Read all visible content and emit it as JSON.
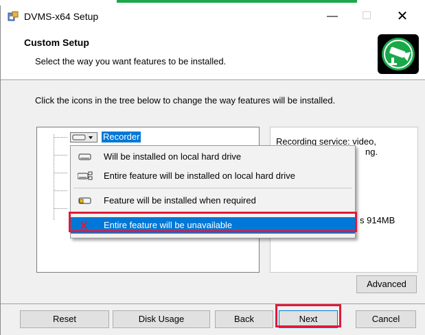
{
  "window": {
    "title": "DVMS-x64 Setup",
    "minimize_glyph": "—",
    "maximize_glyph": "☐",
    "close_glyph": "✕"
  },
  "header": {
    "title": "Custom Setup",
    "subtitle": "Select the way you want features to be installed."
  },
  "instruction": "Click the icons in the tree below to change the way features will be installed.",
  "tree": {
    "selected_feature": "Recorder"
  },
  "description": {
    "line1": "Recording service: video,",
    "line2": "ng.",
    "size_text": "s 914MB"
  },
  "context_menu": {
    "items": [
      {
        "label": "Will be installed on local hard drive",
        "icon": "hard-drive-icon"
      },
      {
        "label": "Entire feature will be installed on local hard drive",
        "icon": "hard-drive-tree-icon"
      },
      {
        "label": "Feature will be installed when required",
        "icon": "on-demand-drive-icon"
      },
      {
        "label": "Entire feature will be unavailable",
        "icon": "red-x-icon"
      }
    ],
    "selected_index": 3
  },
  "buttons": {
    "advanced": "Advanced",
    "reset": "Reset",
    "disk_usage": "Disk Usage",
    "back": "Back",
    "next": "Next",
    "cancel": "Cancel"
  },
  "colors": {
    "selection": "#0078d7",
    "highlight": "#e0193a",
    "logo_green": "#1aa84a"
  }
}
